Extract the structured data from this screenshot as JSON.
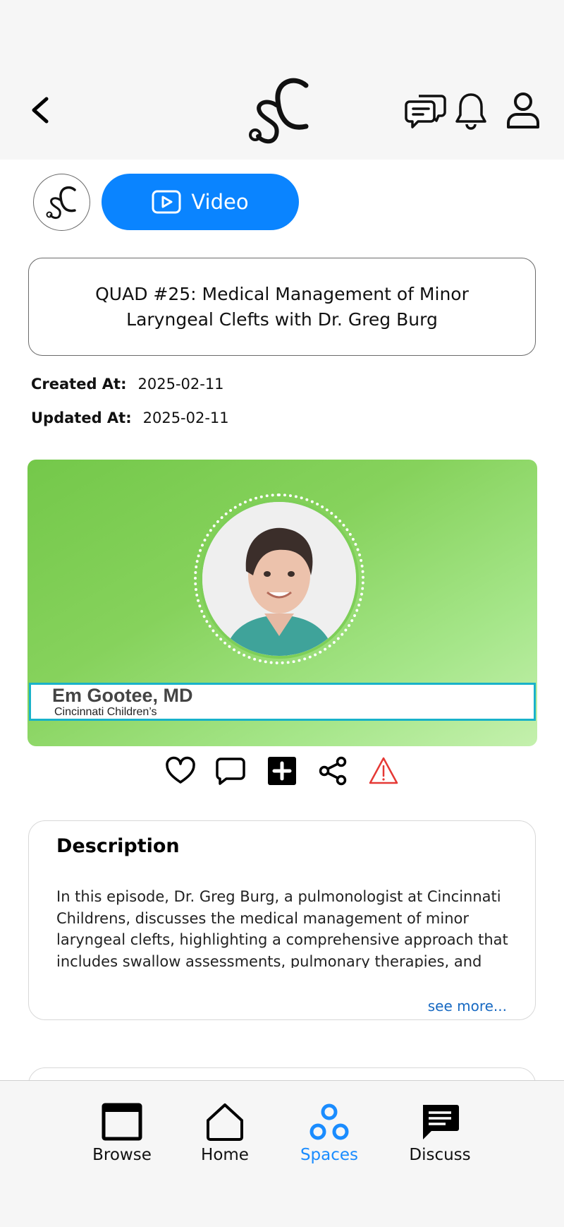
{
  "header": {
    "back_icon": "chevron-left-icon",
    "logo_icon": "sc-logo",
    "icons": [
      "chat-bubbles-icon",
      "bell-icon",
      "user-icon"
    ]
  },
  "space": {
    "avatar_icon": "sc-logo",
    "type_label": "Video",
    "type_icon": "play-icon",
    "accent": "#0a84ff"
  },
  "post": {
    "title": "QUAD #25: Medical Management of Minor Laryngeal Clefts with Dr. Greg Burg",
    "created_label": "Created At:",
    "created_value": "2025-02-11",
    "updated_label": "Updated At:",
    "updated_value": "2025-02-11"
  },
  "media": {
    "name": "Em Gootee, MD",
    "affiliation": "Cincinnati Children’s",
    "band_color": "#19b2c9"
  },
  "actions": [
    "heart-icon",
    "comment-icon",
    "add-icon",
    "share-icon",
    "report-warning-icon"
  ],
  "description": {
    "heading": "Description",
    "body": "In this episode, Dr. Greg Burg, a pulmonologist at Cincinnati Childrens, discusses the medical management of minor laryngeal clefts, highlighting a comprehensive approach that includes swallow assessments, pulmonary therapies, and long-term monitoring. Learn how a",
    "see_more": "see more..."
  },
  "tabs": [
    {
      "label": "Browse",
      "icon": "browser-window-icon"
    },
    {
      "label": "Home",
      "icon": "home-icon"
    },
    {
      "label": "Spaces",
      "icon": "spaces-icon",
      "active": true
    },
    {
      "label": "Discuss",
      "icon": "message-icon"
    }
  ]
}
